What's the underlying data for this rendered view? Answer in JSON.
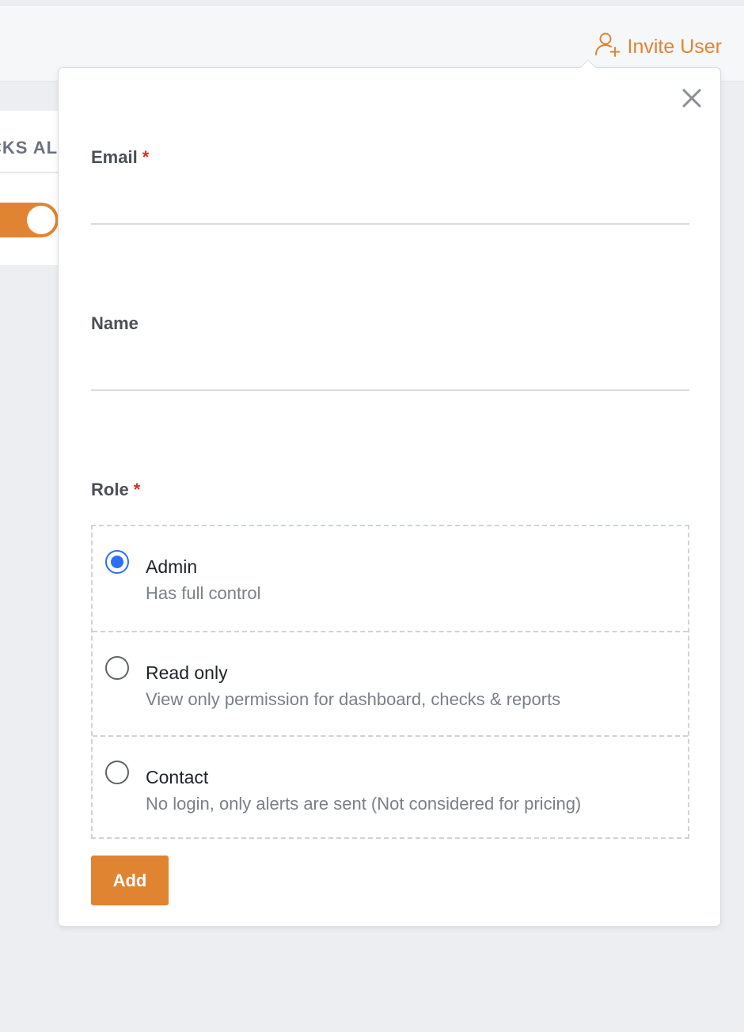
{
  "colors": {
    "accent": "#e08431",
    "radio_selected": "#2d6ff0",
    "required": "#d93025"
  },
  "header": {
    "invite_label": "Invite User",
    "invite_icon": "user-plus-icon"
  },
  "background": {
    "section_heading_fragment": "CKS AL",
    "toggle_on": true
  },
  "form": {
    "close_icon": "close-icon",
    "email": {
      "label": "Email",
      "required_mark": "*",
      "value": "",
      "placeholder": ""
    },
    "name": {
      "label": "Name",
      "value": "",
      "placeholder": ""
    },
    "role": {
      "label": "Role",
      "required_mark": "*",
      "selected": "Admin",
      "options": [
        {
          "title": "Admin",
          "description": "Has full control",
          "checked": true
        },
        {
          "title": "Read only",
          "description": "View only permission for dashboard, checks & reports",
          "checked": false
        },
        {
          "title": "Contact",
          "description": "No login, only alerts are sent (Not considered for pricing)",
          "checked": false
        }
      ]
    },
    "submit_label": "Add"
  }
}
